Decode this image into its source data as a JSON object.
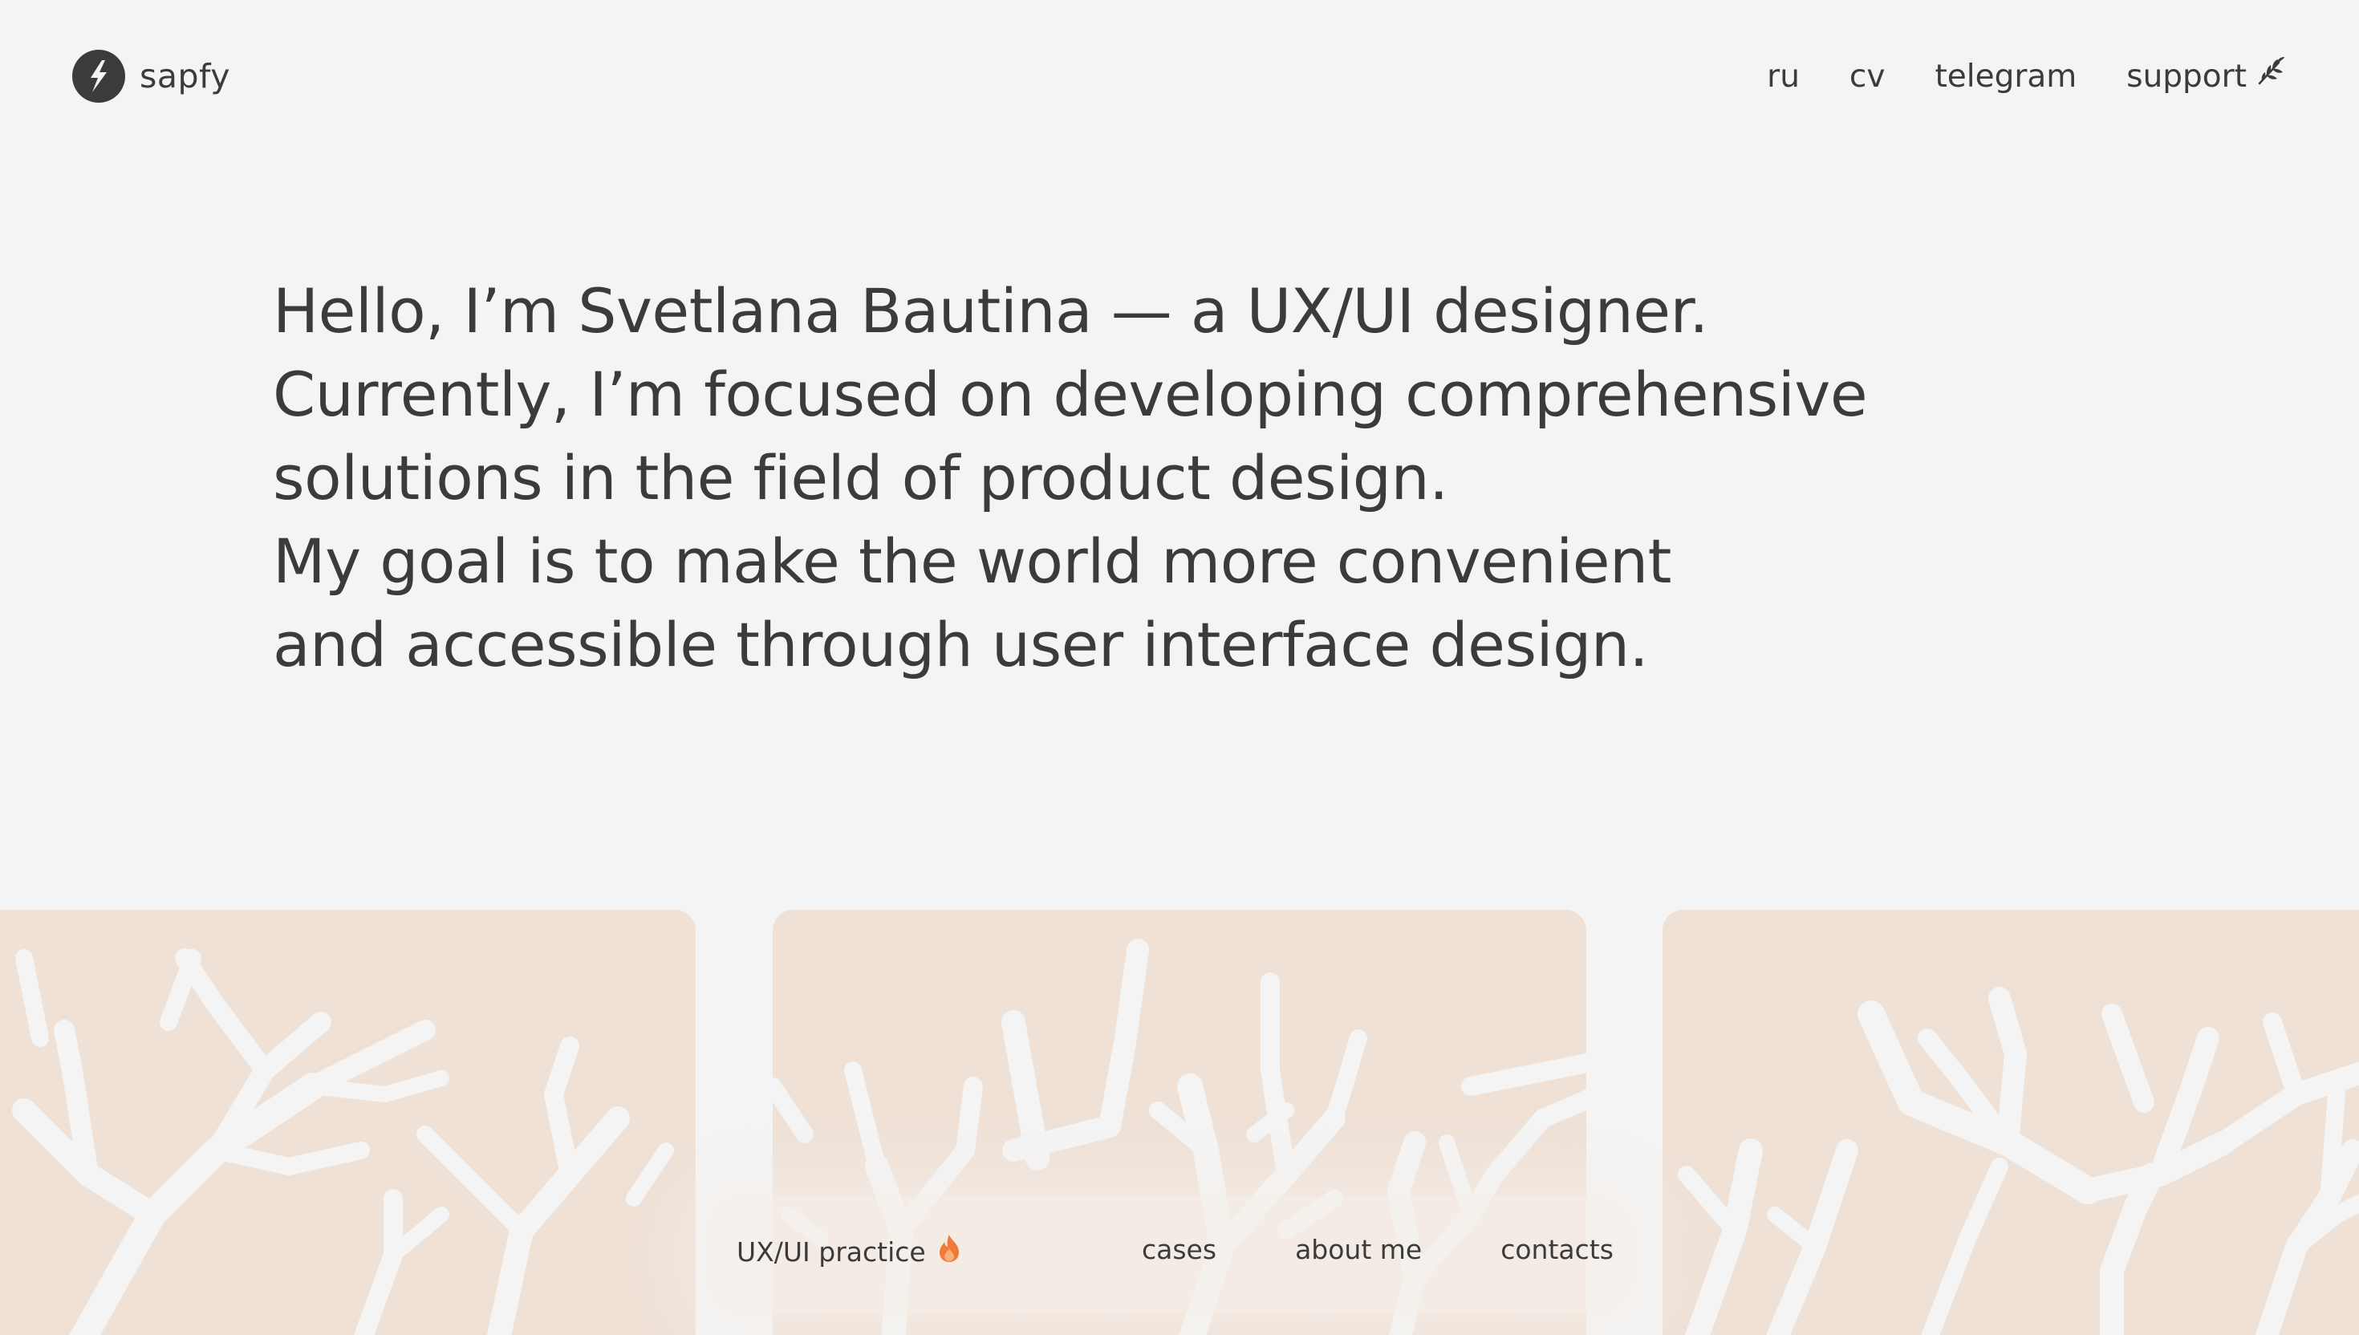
{
  "header": {
    "brand": "sapfy",
    "nav": [
      {
        "label": "ru"
      },
      {
        "label": "cv"
      },
      {
        "label": "telegram"
      },
      {
        "label": "support",
        "icon": "leaf-icon"
      }
    ]
  },
  "hero": {
    "lines": [
      "Hello, I’m Svetlana Bautina — a UX/UI designer.",
      "Currently, I’m focused on developing comprehensive",
      "solutions in the field of product design.",
      "My goal is to make the world more convenient",
      "and accessible through user interface design."
    ]
  },
  "bottom_bar": {
    "practice_label": "UX/UI practice",
    "practice_icon": "fire-icon",
    "links": [
      {
        "label": "cases"
      },
      {
        "label": "about me"
      },
      {
        "label": "contacts"
      }
    ]
  },
  "colors": {
    "background": "#f4f4f4",
    "text": "#3b3b3c",
    "card": "#efe1d6",
    "branches": "#f4f4f4",
    "fire": "#f07a3a"
  }
}
